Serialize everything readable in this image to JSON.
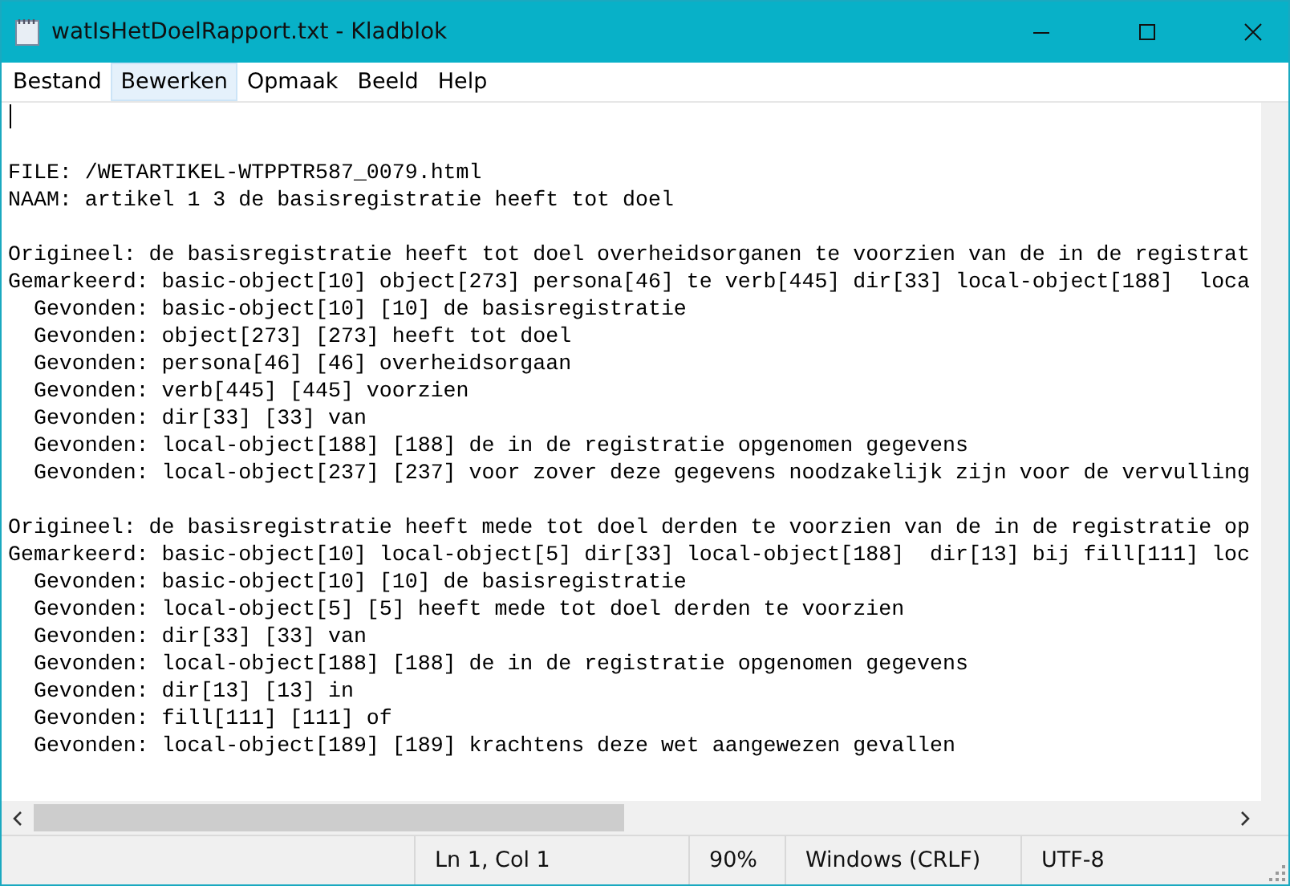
{
  "window": {
    "title": "watIsHetDoelRapport.txt - Kladblok"
  },
  "menu": [
    {
      "label": "Bestand",
      "selected": false
    },
    {
      "label": "Bewerken",
      "selected": true
    },
    {
      "label": "Opmaak",
      "selected": false
    },
    {
      "label": "Beeld",
      "selected": false
    },
    {
      "label": "Help",
      "selected": false
    }
  ],
  "editor": {
    "paragraphs": [
      [
        "FILE: /WETARTIKEL-WTPPTR587_0079.html",
        "NAAM: artikel 1 3 de basisregistratie heeft tot doel"
      ],
      [
        "Origineel: de basisregistratie heeft tot doel overheidsorganen te voorzien van de in de registrat",
        "Gemarkeerd: basic-object[10] object[273] persona[46] te verb[445] dir[33] local-object[188]  loca",
        "  Gevonden: basic-object[10] [10] de basisregistratie",
        "  Gevonden: object[273] [273] heeft tot doel",
        "  Gevonden: persona[46] [46] overheidsorgaan",
        "  Gevonden: verb[445] [445] voorzien",
        "  Gevonden: dir[33] [33] van",
        "  Gevonden: local-object[188] [188] de in de registratie opgenomen gegevens",
        "  Gevonden: local-object[237] [237] voor zover deze gegevens noodzakelijk zijn voor de vervulling"
      ],
      [
        "Origineel: de basisregistratie heeft mede tot doel derden te voorzien van de in de registratie op",
        "Gemarkeerd: basic-object[10] local-object[5] dir[33] local-object[188]  dir[13] bij fill[111] loc",
        "  Gevonden: basic-object[10] [10] de basisregistratie",
        "  Gevonden: local-object[5] [5] heeft mede tot doel derden te voorzien",
        "  Gevonden: dir[33] [33] van",
        "  Gevonden: local-object[188] [188] de in de registratie opgenomen gegevens",
        "  Gevonden: dir[13] [13] in",
        "  Gevonden: fill[111] [111] of",
        "  Gevonden: local-object[189] [189] krachtens deze wet aangewezen gevallen"
      ]
    ]
  },
  "status_bar": [
    "Ln 1, Col 1",
    "90%",
    "Windows (CRLF)",
    "UTF-8"
  ]
}
